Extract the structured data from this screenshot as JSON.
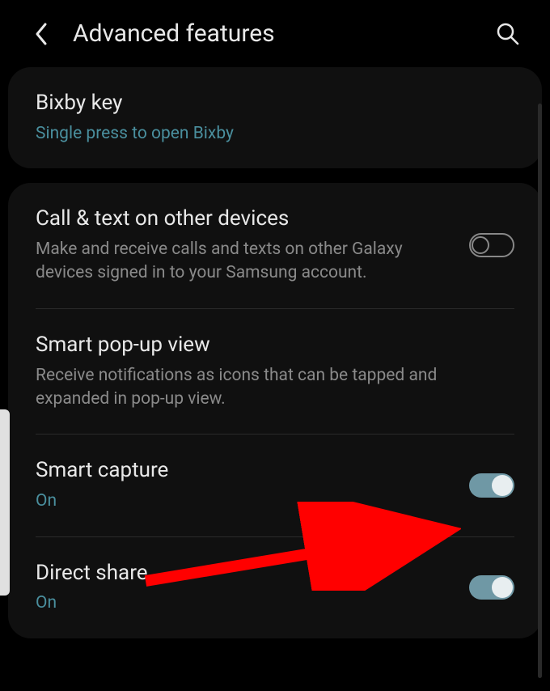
{
  "header": {
    "title": "Advanced features"
  },
  "group1": {
    "bixby": {
      "title": "Bixby key",
      "sub": "Single press to open Bixby"
    }
  },
  "group2": {
    "call_text": {
      "title": "Call & text on other devices",
      "sub": "Make and receive calls and texts on other Galaxy devices signed in to your Samsung account.",
      "toggle": false
    },
    "popup": {
      "title": "Smart pop-up view",
      "sub": "Receive notifications as icons that can be tapped and expanded in pop-up view."
    },
    "capture": {
      "title": "Smart capture",
      "sub": "On",
      "toggle": true
    },
    "direct_share": {
      "title": "Direct share",
      "sub": "On",
      "toggle": true
    }
  }
}
